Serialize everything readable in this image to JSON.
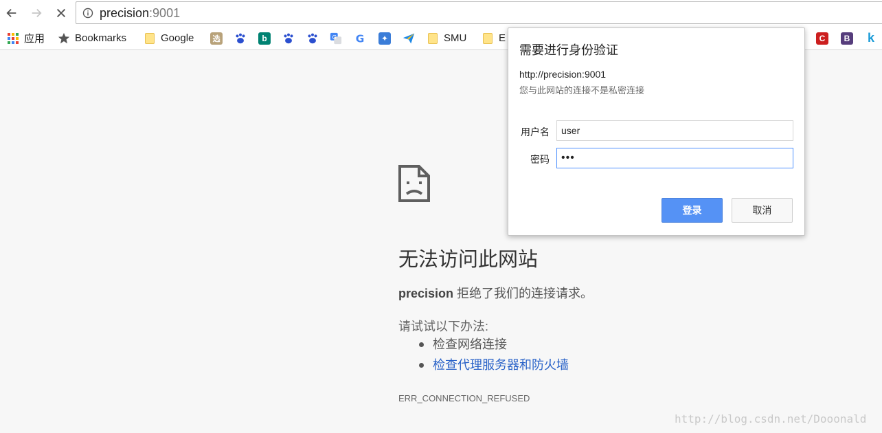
{
  "toolbar": {
    "url_host": "precision",
    "url_port": ":9001"
  },
  "bookmarks": [
    {
      "label": "应用",
      "icon": "apps-grid-icon"
    },
    {
      "label": "Bookmarks",
      "icon": "star-icon"
    },
    {
      "label": "Google",
      "icon": "folder-icon"
    },
    {
      "label": "",
      "icon": "xuan-icon"
    },
    {
      "label": "",
      "icon": "baidu-paw-icon"
    },
    {
      "label": "",
      "icon": "bing-icon"
    },
    {
      "label": "",
      "icon": "baidu-du-icon"
    },
    {
      "label": "",
      "icon": "baidu-paw-icon"
    },
    {
      "label": "",
      "icon": "google-translate-icon"
    },
    {
      "label": "",
      "icon": "google-g-icon"
    },
    {
      "label": "",
      "icon": "puzzle-icon"
    },
    {
      "label": "",
      "icon": "paper-plane-icon"
    },
    {
      "label": "SMU",
      "icon": "folder-icon"
    },
    {
      "label": "E",
      "icon": "folder-icon"
    }
  ],
  "bookmarks_right": [
    {
      "icon": "c-logo-icon",
      "text": "C",
      "color": "#cc1f1f"
    },
    {
      "icon": "b-logo-icon",
      "text": "B",
      "color": "#563d7c"
    },
    {
      "icon": "k-logo-icon",
      "text": "k",
      "color": "#1a9bd7"
    }
  ],
  "error": {
    "title": "无法访问此网站",
    "host": "precision",
    "desc": " 拒绝了我们的连接请求。",
    "try_label": "请试试以下办法:",
    "suggestions": [
      "检查网络连接",
      "检查代理服务器和防火墙"
    ],
    "code": "ERR_CONNECTION_REFUSED"
  },
  "dialog": {
    "title": "需要进行身份验证",
    "origin": "http://precision:9001",
    "note": "您与此网站的连接不是私密连接",
    "username_label": "用户名",
    "username_value": "user",
    "password_label": "密码",
    "password_value": "•••",
    "login_label": "登录",
    "cancel_label": "取消"
  },
  "watermark": "http://blog.csdn.net/Dooonald",
  "colors": {
    "primary_button": "#5592f5",
    "link": "#2962c8",
    "focus_border": "#4d90fe"
  }
}
